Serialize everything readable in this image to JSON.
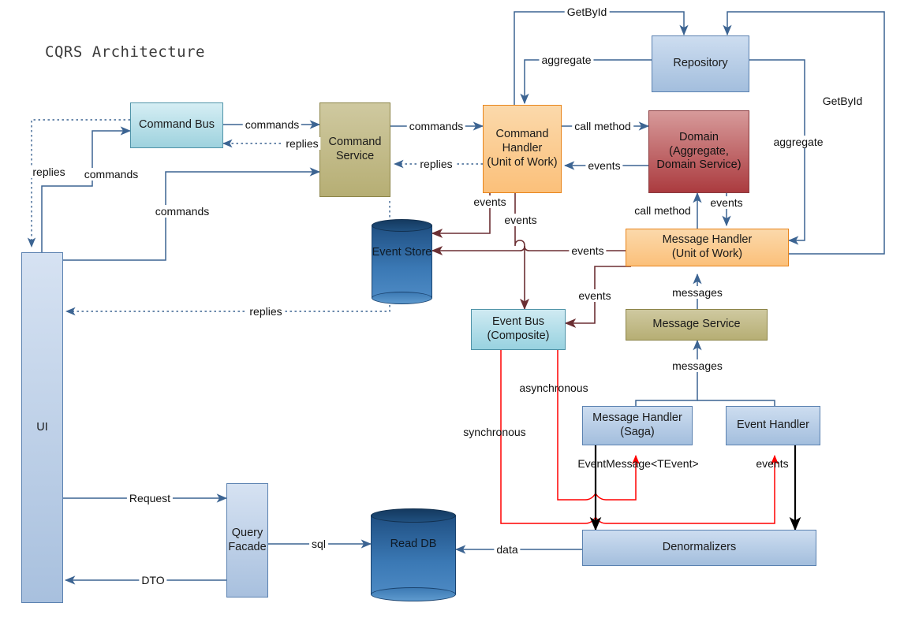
{
  "diagram": {
    "title": "CQRS Architecture",
    "colors": {
      "edge_blue": "#3c6492",
      "edge_dark_red": "#6b2f33",
      "edge_red": "#ff0000",
      "edge_black": "#000000",
      "command_bus_fill": "#9ed2de",
      "service_fill": "#b6ae74",
      "handler_fill": "#fbc07a",
      "domain_fill": "#ab3b3f",
      "blue_fill": "#a3bedd",
      "cylinder_fill": "#3b79b5"
    },
    "nodes": [
      {
        "id": "command_bus",
        "label": "Command Bus",
        "lines": [
          "Command Bus"
        ]
      },
      {
        "id": "command_service",
        "label": "Command Service",
        "lines": [
          "Command",
          "Service"
        ]
      },
      {
        "id": "command_handler",
        "label": "Command Handler (Unit of Work)",
        "lines": [
          "Command",
          "Handler",
          "(Unit of Work)"
        ]
      },
      {
        "id": "domain",
        "label": "Domain (Aggregate, Domain Service)",
        "lines": [
          "Domain",
          "(Aggregate,",
          "Domain Service)"
        ]
      },
      {
        "id": "repository",
        "label": "Repository",
        "lines": [
          "Repository"
        ]
      },
      {
        "id": "event_store",
        "label": "Event Store",
        "lines": [
          "Event",
          "Store"
        ]
      },
      {
        "id": "event_bus",
        "label": "Event Bus (Composite)",
        "lines": [
          "Event Bus",
          "(Composite)"
        ]
      },
      {
        "id": "message_handler_uow",
        "label": "Message Handler (Unit of Work)",
        "lines": [
          "Message Handler",
          "(Unit of Work)"
        ]
      },
      {
        "id": "message_service",
        "label": "Message Service",
        "lines": [
          "Message Service"
        ]
      },
      {
        "id": "message_handler_saga",
        "label": "Message Handler (Saga)",
        "lines": [
          "Message Handler",
          "(Saga)"
        ]
      },
      {
        "id": "event_handler",
        "label": "Event Handler",
        "lines": [
          "Event Handler"
        ]
      },
      {
        "id": "denormalizers",
        "label": "Denormalizers",
        "lines": [
          "Denormalizers"
        ]
      },
      {
        "id": "ui",
        "label": "UI",
        "lines": [
          "UI"
        ]
      },
      {
        "id": "query_facade",
        "label": "Query Facade",
        "lines": [
          "Query",
          "Facade"
        ]
      },
      {
        "id": "read_db",
        "label": "Read DB",
        "lines": [
          "Read DB"
        ]
      }
    ],
    "edge_labels": {
      "commands_bus_to_service": "commands",
      "replies_service_to_bus": "replies",
      "commands_ui_to_bus": "commands",
      "replies_ui": "replies",
      "commands_ui_to_service": "commands",
      "commands_service_to_handler": "commands",
      "replies_handler_to_service": "replies",
      "call_method_handler_domain": "call method",
      "events_domain_to_handler": "events",
      "getbyid_top": "GetById",
      "aggregate_repo_to_handler": "aggregate",
      "getbyid_right": "GetById",
      "aggregate_repo_to_msghandler": "aggregate",
      "events_handler_to_store": "events",
      "events_handler_to_bus": "events",
      "events_msghandler_to_store": "events",
      "call_method_msghandler_domain": "call method",
      "events_domain_to_msghandler": "events",
      "events_msghandler_to_eventbus": "events",
      "messages_service_to_msghandler": "messages",
      "messages_to_service": "messages",
      "replies_service_to_ui": "replies",
      "synchronous": "synchronous",
      "asynchronous": "asynchronous",
      "event_message_tevent": "EventMessage<TEvent>",
      "events_to_event_handler": "events",
      "request": "Request",
      "dto": "DTO",
      "sql": "sql",
      "data": "data"
    }
  }
}
